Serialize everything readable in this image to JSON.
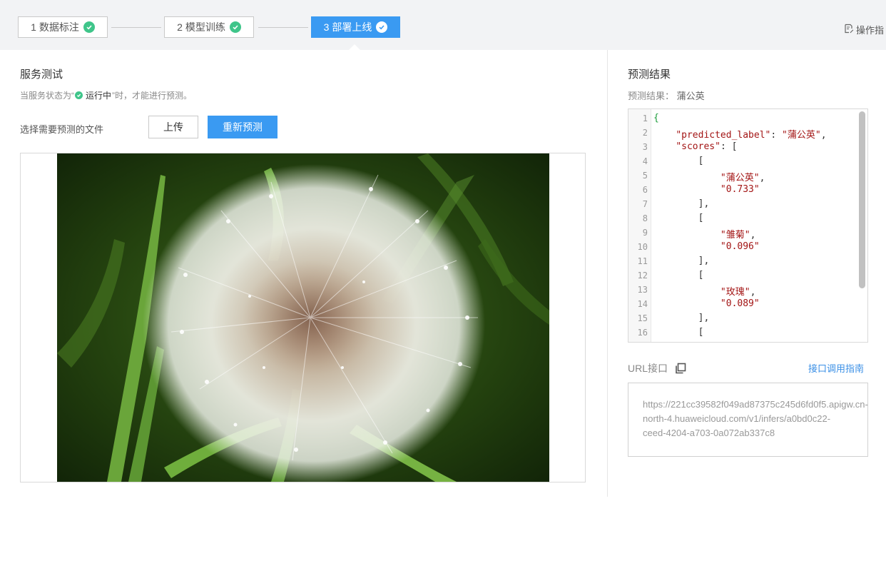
{
  "steps": [
    {
      "label": "1 数据标注"
    },
    {
      "label": "2 模型训练"
    },
    {
      "label": "3 部署上线"
    }
  ],
  "header": {
    "guide_label": "操作指"
  },
  "left": {
    "title": "服务测试",
    "status_prefix": "当服务状态为“",
    "status_running": "运行中",
    "status_suffix": "”时，才能进行预测。",
    "file_label": "选择需要预测的文件",
    "upload_label": "上传",
    "repredict_label": "重新预测"
  },
  "right": {
    "title": "预测结果",
    "result_label": "预测结果：",
    "result_value": "蒲公英",
    "code_line_numbers": [
      "1",
      "2",
      "3",
      "4",
      "5",
      "6",
      "7",
      "8",
      "9",
      "10",
      "11",
      "12",
      "13",
      "14",
      "15",
      "16"
    ],
    "code": {
      "l1": "{",
      "l2_key": "\"predicted_label\"",
      "l2_rest": ": ",
      "l2_val": "\"蒲公英\"",
      "l2_end": ",",
      "l3_key": "\"scores\"",
      "l3_rest": ": [",
      "l4": "[",
      "l5": "\"蒲公英\"",
      "l5_end": ",",
      "l6": "\"0.733\"",
      "l7": "],",
      "l8": "[",
      "l9": "\"雏菊\"",
      "l9_end": ",",
      "l10": "\"0.096\"",
      "l11": "],",
      "l12": "[",
      "l13": "\"玫瑰\"",
      "l13_end": ",",
      "l14": "\"0.089\"",
      "l15": "],",
      "l16": "["
    },
    "url_label": "URL接口",
    "api_guide_label": "接口调用指南",
    "url_lines": [
      "https://221cc39582f049ad87375c245d6fd0f5.apigw.cn-",
      "north-4.huaweicloud.com/v1/infers/a0bd0c22-",
      "ceed-4204-a703-0a072ab337c8"
    ]
  },
  "colors": {
    "primary": "#3a9af2",
    "success": "#3fc58a",
    "link": "#3a8fe6"
  },
  "icons": [
    "check-circle-icon",
    "edit-doc-icon",
    "copy-icon"
  ]
}
